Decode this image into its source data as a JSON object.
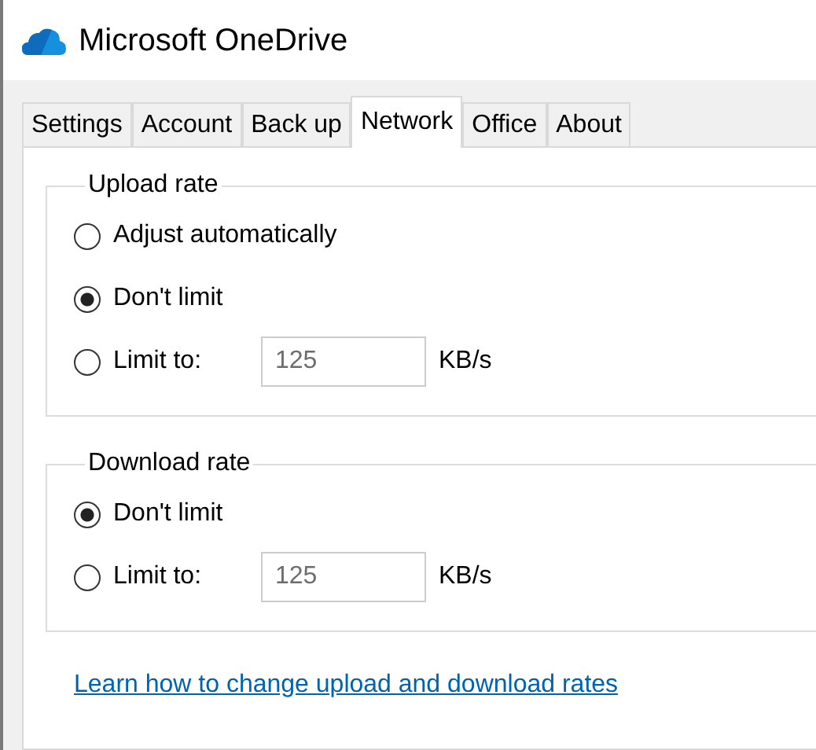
{
  "window": {
    "title": "Microsoft OneDrive"
  },
  "tabs": [
    {
      "label": "Settings",
      "selected": false
    },
    {
      "label": "Account",
      "selected": false
    },
    {
      "label": "Back up",
      "selected": false
    },
    {
      "label": "Network",
      "selected": true
    },
    {
      "label": "Office",
      "selected": false
    },
    {
      "label": "About",
      "selected": false
    }
  ],
  "groups": [
    {
      "title": "Upload rate",
      "options": [
        {
          "kind": "plain",
          "label": "Adjust automatically",
          "selected": false
        },
        {
          "kind": "plain",
          "label": "Don't limit",
          "selected": true
        },
        {
          "kind": "limit",
          "label": "Limit to:",
          "selected": false,
          "value": "125",
          "unit": "KB/s"
        }
      ]
    },
    {
      "title": "Download rate",
      "options": [
        {
          "kind": "plain",
          "label": "Don't limit",
          "selected": true
        },
        {
          "kind": "limit",
          "label": "Limit to:",
          "selected": false,
          "value": "125",
          "unit": "KB/s"
        }
      ]
    }
  ],
  "link": "Learn how to change upload and download rates"
}
